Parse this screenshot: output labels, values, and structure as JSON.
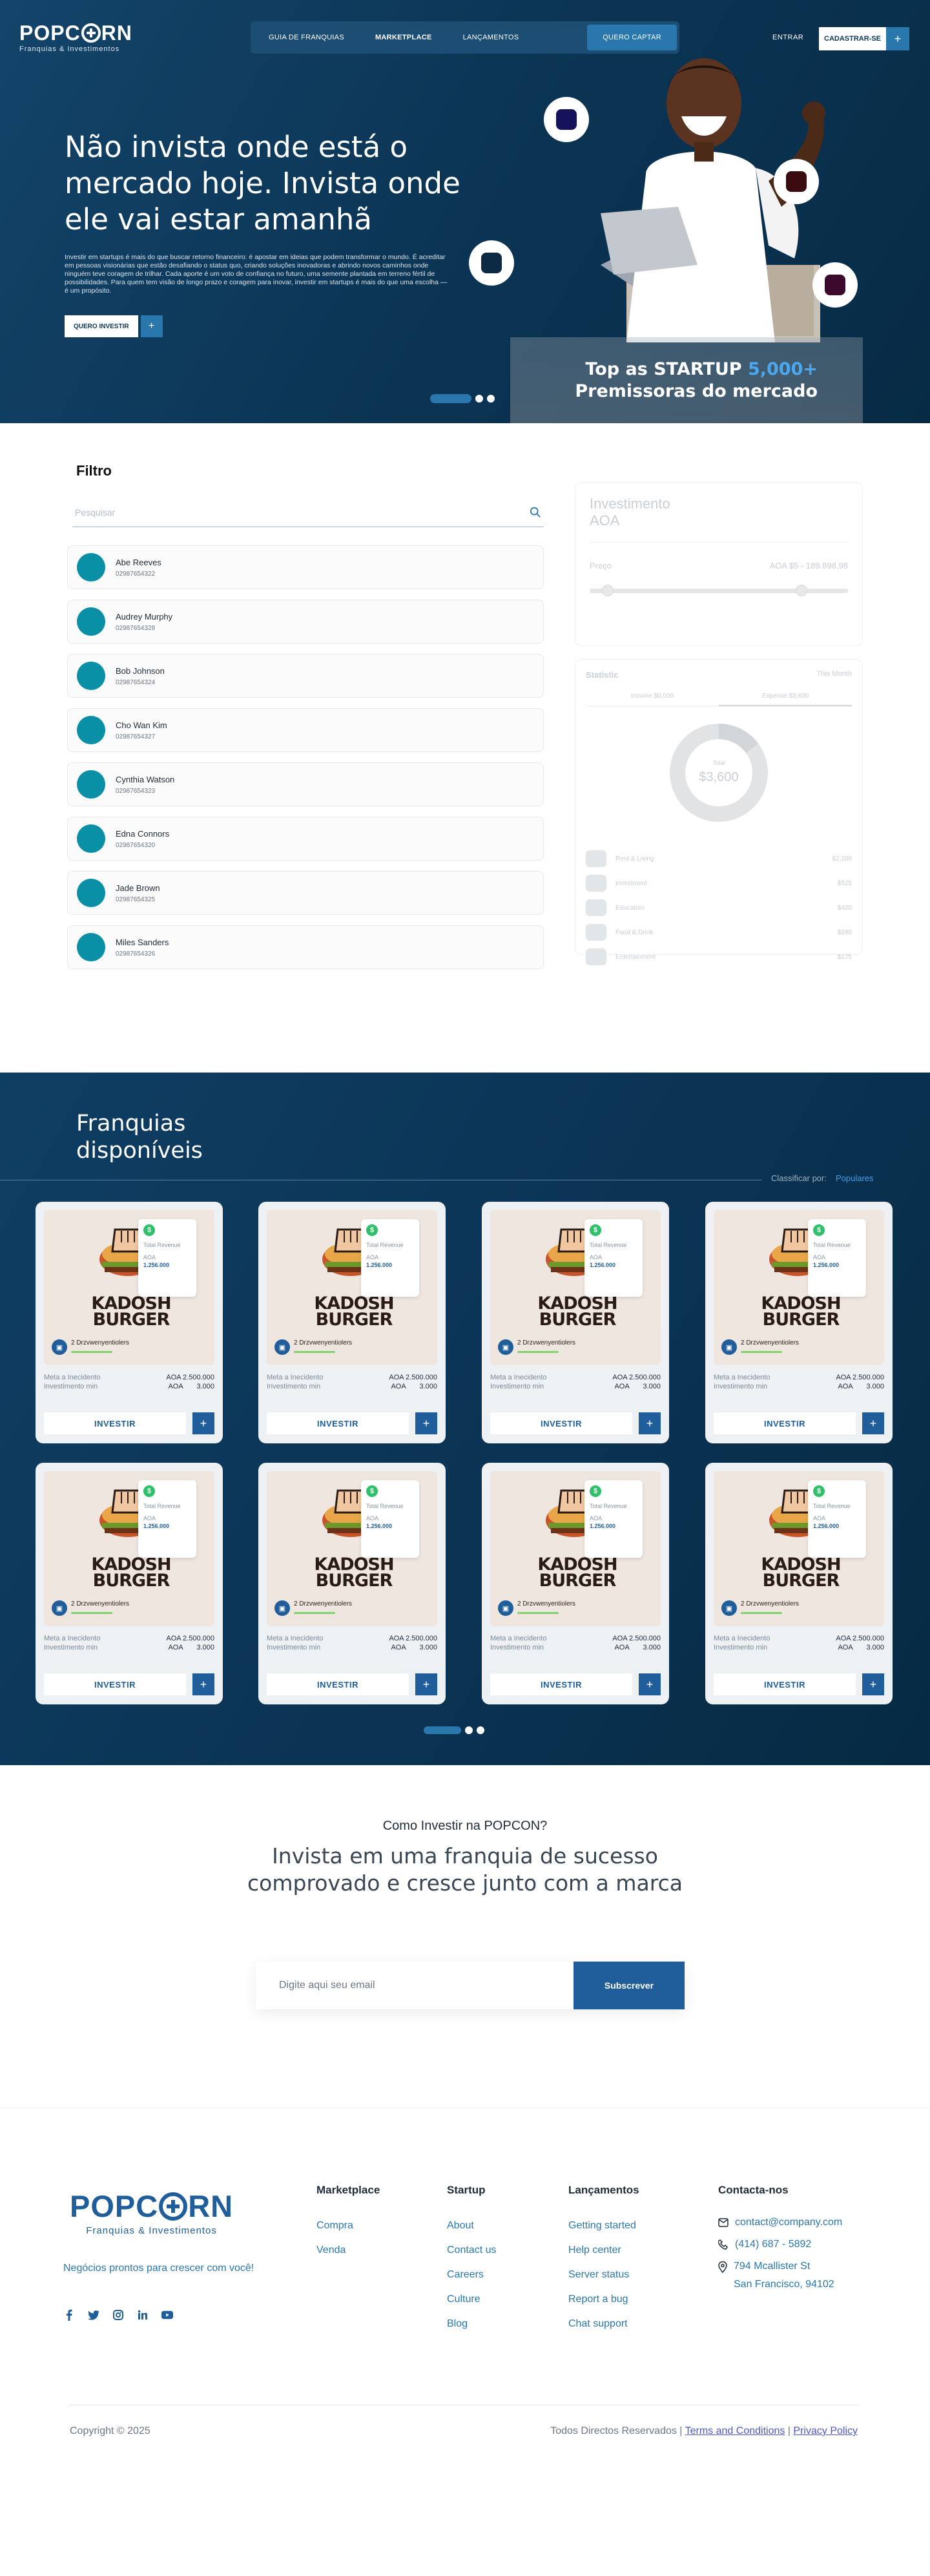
{
  "brand": {
    "logo_left": "POPC",
    "logo_right": "RN",
    "tagline": "Franquias & Investimentos"
  },
  "nav": {
    "items": [
      "GUIA DE FRANQUIAS",
      "MARKETPLACE",
      "LANÇAMENTOS",
      "QUERO CAPTAR"
    ],
    "login": "ENTRAR",
    "signup": "CADASTRAR-SE",
    "signup_plus": "+"
  },
  "hero": {
    "title": "Não invista onde está o mercado hoje. Invista onde ele vai estar amanhã",
    "subtitle": "Investir em startups é mais do que buscar retorno financeiro: é apostar em ideias que podem transformar o mundo. É acreditar em pessoas visionárias que estão desafiando o status quo, criando soluções inovadoras e abrindo novos caminhos onde ninguém teve coragem de trilhar. Cada aporte é um voto de confiança no futuro, uma semente plantada em terreno fértil de possibilidades. Para quem tem visão de longo prazo e coragem para inovar, investir em startups é mais do que uma escolha — é um propósito.",
    "cta": "QUERO INVESTIR",
    "cta_plus": "+",
    "banner_line1_pre": "Top as STARTUP ",
    "banner_line1_hl": "5,000+",
    "banner_line2": "Premissoras do mercado"
  },
  "filter": {
    "title": "Filtro",
    "search_placeholder": "Pesquisar",
    "users": [
      {
        "name": "Abe Reeves",
        "phone": "02987654322"
      },
      {
        "name": "Audrey Murphy",
        "phone": "02987654328"
      },
      {
        "name": "Bob Johnson",
        "phone": "02987654324"
      },
      {
        "name": "Cho Wan Kim",
        "phone": "02987654327"
      },
      {
        "name": "Cynthia Watson",
        "phone": "02987654323"
      },
      {
        "name": "Edna Connors",
        "phone": "02987654320"
      },
      {
        "name": "Jade Brown",
        "phone": "02987654325"
      },
      {
        "name": "Miles Sanders",
        "phone": "02987654326"
      }
    ]
  },
  "invest_panel": {
    "title_line1": "Investimento",
    "title_line2": "AOA",
    "price_label": "Preço",
    "price_range": "AOA $5 - 189.898,98",
    "price_range_min": 0.05,
    "price_range_max": 0.83
  },
  "stats_panel": {
    "title": "Statistic",
    "period": "This Month",
    "tabs": [
      "Income",
      "Expense"
    ],
    "tab_values": [
      "$0,000",
      "$3,600"
    ],
    "donut_label": "Total",
    "donut_value": "$3,600",
    "rows": [
      {
        "label": "Rent & Living",
        "value": "$2,100"
      },
      {
        "label": "Investment",
        "value": "$525"
      },
      {
        "label": "Education",
        "value": "$420"
      },
      {
        "label": "Food & Drink",
        "value": "$280"
      },
      {
        "label": "Entertainment",
        "value": "$175"
      }
    ]
  },
  "franchises": {
    "title_line1": "Franquias",
    "title_line2": "disponíveis",
    "sort_label": "Classificar por:",
    "sort_value": "Populares",
    "cards": [
      {
        "brand": "KADOSH BURGER"
      },
      {
        "brand": "KADOSH BURGER"
      },
      {
        "brand": "KADOSH BURGER"
      },
      {
        "brand": "KADOSH BURGER"
      },
      {
        "brand": "KADOSH BURGER"
      },
      {
        "brand": "KADOSH BURGER"
      },
      {
        "brand": "KADOSH BURGER"
      },
      {
        "brand": "KADOSH BURGER"
      }
    ],
    "card_common": {
      "rev_title": "Total Revenue",
      "rev_currency": "AOA",
      "rev_value": "1.256.000",
      "region": "2 Drzvwenyentiolers",
      "row1_label": "Meta a Inecidento",
      "row1_value": "AOA 2.500.000",
      "row2_label": "Investimento min",
      "row2_value": "AOA       3.000",
      "invest": "INVESTIR",
      "plus": "+"
    }
  },
  "howto": {
    "eyebrow": "Como Investir na POPCON?",
    "headline": "Invista em uma franquia de sucesso comprovado e cresce junto com a marca",
    "email_placeholder": "Digite aqui seu email",
    "subscribe": "Subscrever"
  },
  "footer": {
    "logo_left": "POPC",
    "logo_right": "RN",
    "tagline": "Franquias & Investimentos",
    "slogan": "Negócios prontos para crescer com você!",
    "social": [
      "facebook-icon",
      "twitter-icon",
      "instagram-icon",
      "linkedin-icon",
      "youtube-icon"
    ],
    "columns": [
      {
        "title": "Marketplace",
        "links": [
          "Compra",
          "Venda"
        ]
      },
      {
        "title": "Startup",
        "links": [
          "About",
          "Contact us",
          "Careers",
          "Culture",
          "Blog"
        ]
      },
      {
        "title": "Lançamentos",
        "links": [
          "Getting started",
          "Help center",
          "Server status",
          "Report a bug",
          "Chat support"
        ]
      }
    ],
    "contact": {
      "title": "Contacta-nos",
      "email": "contact@company.com",
      "phone": "(414) 687 - 5892",
      "address_line1": "794 Mcallister St",
      "address_line2": "San Francisco, 94102"
    },
    "copyright": "Copyright © 2025",
    "rights": "Todos Directos Reservados | ",
    "terms": "Terms and Conditions",
    "sep": " | ",
    "privacy": "Privacy Policy"
  },
  "colors": {
    "navy": "#0c3656",
    "accent": "#2a77ad",
    "link": "#2a77ad"
  }
}
